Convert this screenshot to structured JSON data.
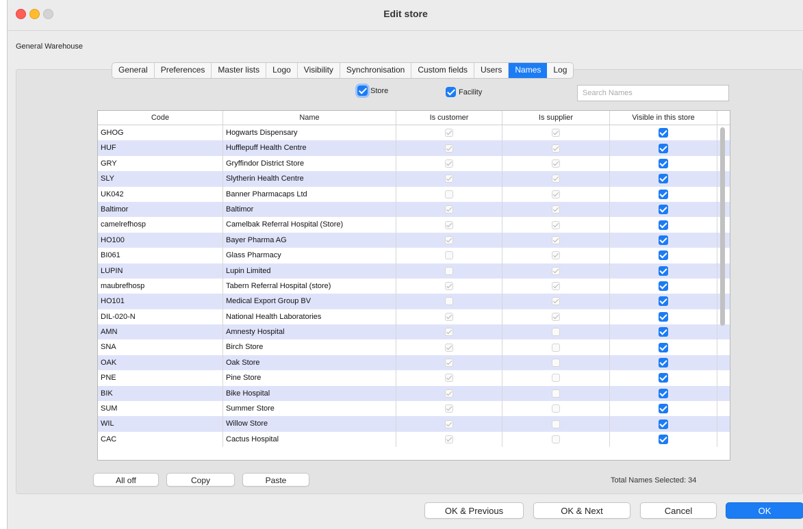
{
  "window": {
    "title": "Edit store"
  },
  "store_name": "General Warehouse",
  "tabs": [
    "General",
    "Preferences",
    "Master lists",
    "Logo",
    "Visibility",
    "Synchronisation",
    "Custom fields",
    "Users",
    "Names",
    "Log"
  ],
  "active_tab": "Names",
  "filters": {
    "store_label": "Store",
    "facility_label": "Facility",
    "store_checked": true,
    "facility_checked": true
  },
  "search": {
    "placeholder": "Search Names",
    "value": ""
  },
  "table": {
    "columns": [
      "Code",
      "Name",
      "Is customer",
      "Is supplier",
      "Visible in this store"
    ],
    "rows": [
      {
        "code": "GHOG",
        "name": "Hogwarts Dispensary",
        "is_customer": true,
        "is_supplier": true,
        "visible": true
      },
      {
        "code": "HUF",
        "name": "Hufflepuff Health Centre",
        "is_customer": true,
        "is_supplier": true,
        "visible": true
      },
      {
        "code": "GRY",
        "name": "Gryffindor District Store",
        "is_customer": true,
        "is_supplier": true,
        "visible": true
      },
      {
        "code": "SLY",
        "name": "Slytherin Health Centre",
        "is_customer": true,
        "is_supplier": true,
        "visible": true
      },
      {
        "code": "UK042",
        "name": "Banner Pharmacaps Ltd",
        "is_customer": false,
        "is_supplier": true,
        "visible": true
      },
      {
        "code": "Baltimor",
        "name": "Baltimor",
        "is_customer": true,
        "is_supplier": true,
        "visible": true
      },
      {
        "code": "camelrefhosp",
        "name": "Camelbak Referral Hospital (Store)",
        "is_customer": true,
        "is_supplier": true,
        "visible": true
      },
      {
        "code": "HO100",
        "name": "Bayer Pharma AG",
        "is_customer": true,
        "is_supplier": true,
        "visible": true
      },
      {
        "code": "BI061",
        "name": "Glass Pharmacy",
        "is_customer": false,
        "is_supplier": true,
        "visible": true
      },
      {
        "code": "LUPIN",
        "name": "Lupin Limited",
        "is_customer": false,
        "is_supplier": true,
        "visible": true
      },
      {
        "code": "maubrefhosp",
        "name": "Tabern Referral Hospital (store)",
        "is_customer": true,
        "is_supplier": true,
        "visible": true
      },
      {
        "code": "HO101",
        "name": "Medical Export Group BV",
        "is_customer": false,
        "is_supplier": true,
        "visible": true
      },
      {
        "code": "DIL-020-N",
        "name": "National Health Laboratories",
        "is_customer": true,
        "is_supplier": true,
        "visible": true
      },
      {
        "code": "AMN",
        "name": "Amnesty Hospital",
        "is_customer": true,
        "is_supplier": false,
        "visible": true
      },
      {
        "code": "SNA",
        "name": "Birch Store",
        "is_customer": true,
        "is_supplier": false,
        "visible": true
      },
      {
        "code": "OAK",
        "name": "Oak Store",
        "is_customer": true,
        "is_supplier": false,
        "visible": true
      },
      {
        "code": "PNE",
        "name": "Pine Store",
        "is_customer": true,
        "is_supplier": false,
        "visible": true
      },
      {
        "code": "BIK",
        "name": "Bike Hospital",
        "is_customer": true,
        "is_supplier": false,
        "visible": true
      },
      {
        "code": "SUM",
        "name": "Summer Store",
        "is_customer": true,
        "is_supplier": false,
        "visible": true
      },
      {
        "code": "WIL",
        "name": "Willow Store",
        "is_customer": true,
        "is_supplier": false,
        "visible": true
      },
      {
        "code": "CAC",
        "name": "Cactus Hospital",
        "is_customer": true,
        "is_supplier": false,
        "visible": true
      }
    ]
  },
  "buttons": {
    "all_off": "All off",
    "copy": "Copy",
    "paste": "Paste",
    "ok_previous": "OK & Previous",
    "ok_next": "OK & Next",
    "cancel": "Cancel",
    "ok": "OK"
  },
  "total_label": "Total Names Selected: 34",
  "colors": {
    "accent": "#1c7cf4",
    "row_alt": "#dfe3fa"
  }
}
